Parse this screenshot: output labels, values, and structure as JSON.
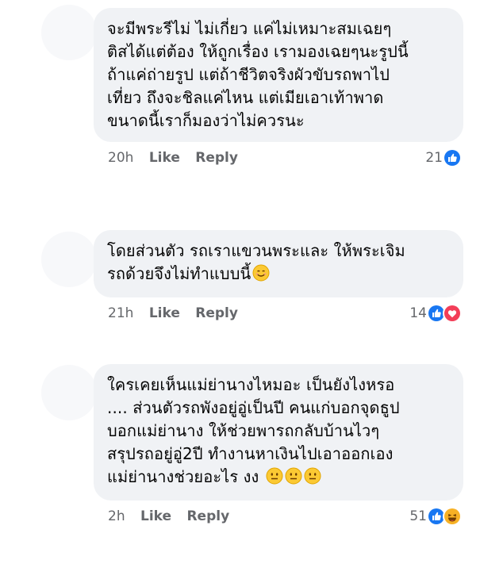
{
  "comments": [
    {
      "text": "จะมีพระรีไม่ ไม่เกี่ยว แค่ไม่เหมาะสมเฉยๆ\nติสได้แต่ต้อง ให้ถูกเรื่อง เรามองเฉยๆนะรูปนี้\nถ้าแค่ถ่ายรูป  แต่ถ้าชีวิตจริงผัวขับรถพาไป\nเที่ยว ถึงจะชิลแค่ไหน แต่เมียเอาเท้าพาด\nขนาดนี้เราก็มองว่าไม่ควรนะ",
      "time": "20h",
      "like_label": "Like",
      "reply_label": "Reply",
      "reaction_count": "21",
      "reactions": [
        "like"
      ],
      "trailing_emoji": []
    },
    {
      "text": "โดยส่วนตัว รถเราแขวนพระและ ให้พระเจิม\nรถด้วยจึงไม่ทำแบบนี้",
      "time": "21h",
      "like_label": "Like",
      "reply_label": "Reply",
      "reaction_count": "14",
      "reactions": [
        "like",
        "love"
      ],
      "trailing_emoji": [
        "smiling-face"
      ]
    },
    {
      "text": "ใครเคยเห็นแม่ย่านางไหมอะ เป็นยังไงหรอ\n.... ส่วนตัวรถพังอยู่อู่เป็นปี คนแก่บอกจุดธูป\nบอกแม่ย่านาง ให้ช่วยพารถกลับบ้านไวๆ\nสรุปรถอยู่อู่2ปี ทำงานหาเงินไปเอาออกเอง\nแม่ย่านางช่วยอะไร งง",
      "time": "2h",
      "like_label": "Like",
      "reply_label": "Reply",
      "reaction_count": "51",
      "reactions": [
        "like",
        "haha"
      ],
      "trailing_emoji": [
        "neutral-face",
        "neutral-face",
        "neutral-face"
      ]
    }
  ],
  "colors": {
    "bubble": "#f0f2f5",
    "meta_text": "#65676b",
    "like_blue": "#1877f2",
    "love_red": "#f33e58",
    "haha_yellow": "#f7b125"
  }
}
